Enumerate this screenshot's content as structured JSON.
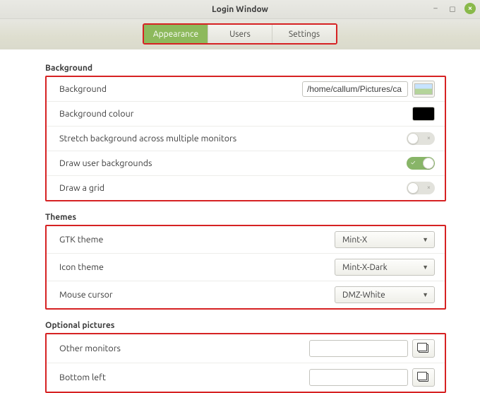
{
  "window": {
    "title": "Login Window"
  },
  "tabs": {
    "appearance": "Appearance",
    "users": "Users",
    "settings": "Settings"
  },
  "sections": {
    "background": {
      "heading": "Background",
      "bg_label": "Background",
      "bg_path": "/home/callum/Pictures/ca",
      "bgcolor_label": "Background colour",
      "bgcolor_value": "#000000",
      "stretch_label": "Stretch background across multiple monitors",
      "stretch_on": false,
      "drawuser_label": "Draw user backgrounds",
      "drawuser_on": true,
      "grid_label": "Draw a grid",
      "grid_on": false
    },
    "themes": {
      "heading": "Themes",
      "gtk_label": "GTK theme",
      "gtk_value": "Mint-X",
      "icon_label": "Icon theme",
      "icon_value": "Mint-X-Dark",
      "cursor_label": "Mouse cursor",
      "cursor_value": "DMZ-White"
    },
    "optional": {
      "heading": "Optional pictures",
      "other_label": "Other monitors",
      "other_value": "",
      "bottom_label": "Bottom left",
      "bottom_value": ""
    }
  }
}
